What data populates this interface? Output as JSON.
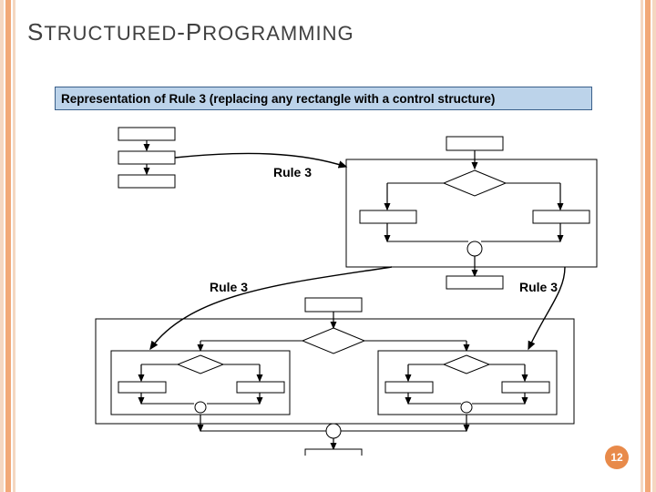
{
  "title_part1": "S",
  "title_part2": "TRUCTURED",
  "title_part3": "-P",
  "title_part4": "ROGRAMMING",
  "caption": "Representation of Rule 3 (replacing any rectangle with a control structure)",
  "labels": {
    "rule_top": "Rule 3",
    "rule_left": "Rule 3",
    "rule_right": "Rule 3"
  },
  "page_number": "12",
  "colors": {
    "caption_bg": "#bcd3ea",
    "caption_border": "#3a5f8a",
    "accent": "#e88a4a",
    "stripe_light": "#f5d7c1",
    "stripe_dark": "#f2a978"
  }
}
